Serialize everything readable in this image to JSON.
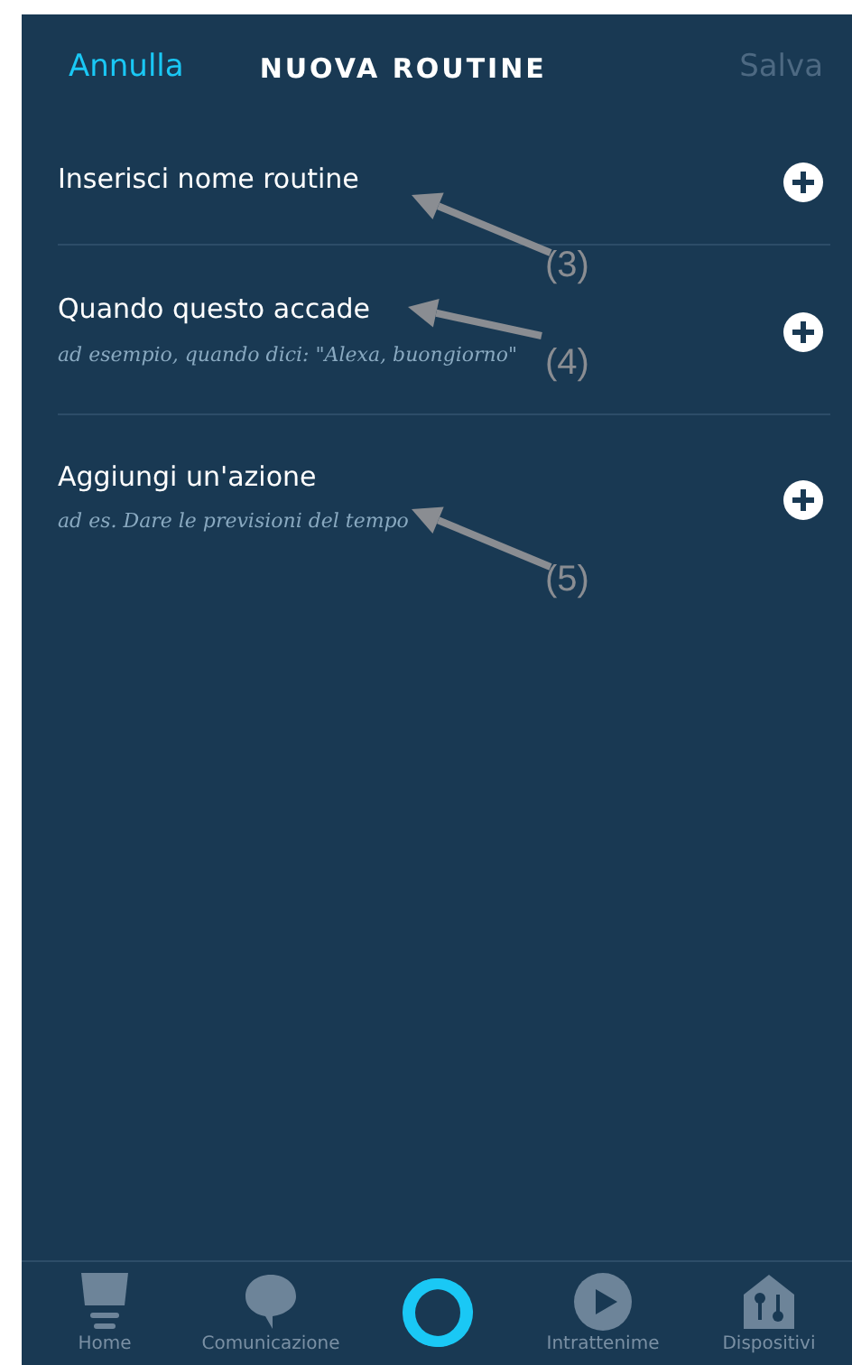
{
  "header": {
    "cancel": "Annulla",
    "title": "NUOVA ROUTINE",
    "save": {
      "label": "Salva",
      "disabled": true
    }
  },
  "rows": [
    {
      "title": "Inserisci nome routine"
    },
    {
      "title": "Quando questo accade",
      "hint": "ad esempio, quando dici: \"Alexa, buongiorno\""
    },
    {
      "title": "Aggiungi un'azione",
      "hint": "ad es. Dare le previsioni del tempo"
    }
  ],
  "annotations": [
    "(3)",
    "(4)",
    "(5)"
  ],
  "bottom_nav": [
    {
      "kind": "tab",
      "label": "Home"
    },
    {
      "kind": "tab",
      "label": "Comunicazione"
    },
    {
      "kind": "voice"
    },
    {
      "kind": "tab",
      "label": "Intrattenime"
    },
    {
      "kind": "tab",
      "label": "Dispositivi"
    }
  ]
}
